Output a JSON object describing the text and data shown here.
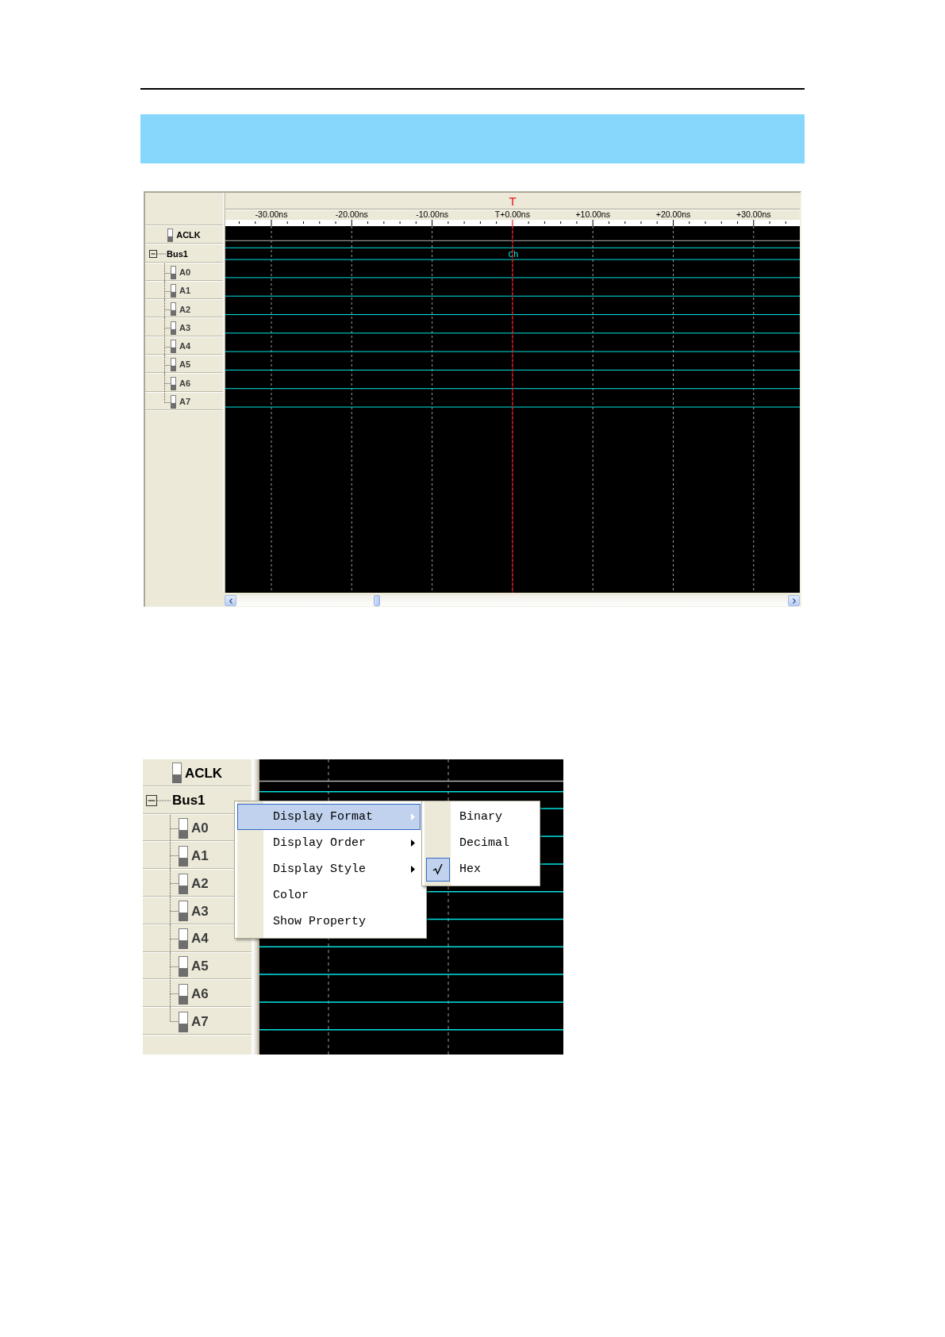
{
  "waveform_window": {
    "trigger_label": "T",
    "time_labels": [
      "-30.00ns",
      "-20.00ns",
      "-10.00ns",
      "T+0.00ns",
      "+10.00ns",
      "+20.00ns",
      "+30.00ns"
    ],
    "signals": [
      {
        "name": "ACLK",
        "kind": "signal"
      },
      {
        "name": "Bus1",
        "kind": "bus",
        "expanded": true,
        "value": "Ch",
        "children": [
          {
            "name": "A0",
            "kind": "bit"
          },
          {
            "name": "A1",
            "kind": "bit"
          },
          {
            "name": "A2",
            "kind": "bit"
          },
          {
            "name": "A3",
            "kind": "bit"
          },
          {
            "name": "A4",
            "kind": "bit"
          },
          {
            "name": "A5",
            "kind": "bit"
          },
          {
            "name": "A6",
            "kind": "bit"
          },
          {
            "name": "A7",
            "kind": "bit"
          }
        ]
      }
    ]
  },
  "menu_window": {
    "signals": [
      {
        "name": "ACLK",
        "kind": "signal"
      },
      {
        "name": "Bus1",
        "kind": "bus",
        "expanded": true,
        "children": [
          {
            "name": "A0",
            "kind": "bit"
          },
          {
            "name": "A1",
            "kind": "bit"
          },
          {
            "name": "A2",
            "kind": "bit"
          },
          {
            "name": "A3",
            "kind": "bit"
          },
          {
            "name": "A4",
            "kind": "bit"
          },
          {
            "name": "A5",
            "kind": "bit"
          },
          {
            "name": "A6",
            "kind": "bit"
          },
          {
            "name": "A7",
            "kind": "bit"
          }
        ]
      }
    ],
    "context_menu": [
      {
        "label": "Display Format",
        "selected": true,
        "opens_submenu": true
      },
      {
        "label": "Display Order",
        "selected": false,
        "opens_submenu": true
      },
      {
        "label": "Display Style",
        "selected": false,
        "opens_submenu": true
      },
      {
        "label": "Color",
        "selected": false,
        "opens_submenu": false
      },
      {
        "label": "Show Property",
        "selected": false,
        "opens_submenu": false
      }
    ],
    "submenu": [
      {
        "label": "Binary",
        "checked": false
      },
      {
        "label": "Decimal",
        "checked": false
      },
      {
        "label": "Hex",
        "checked": true
      }
    ]
  }
}
